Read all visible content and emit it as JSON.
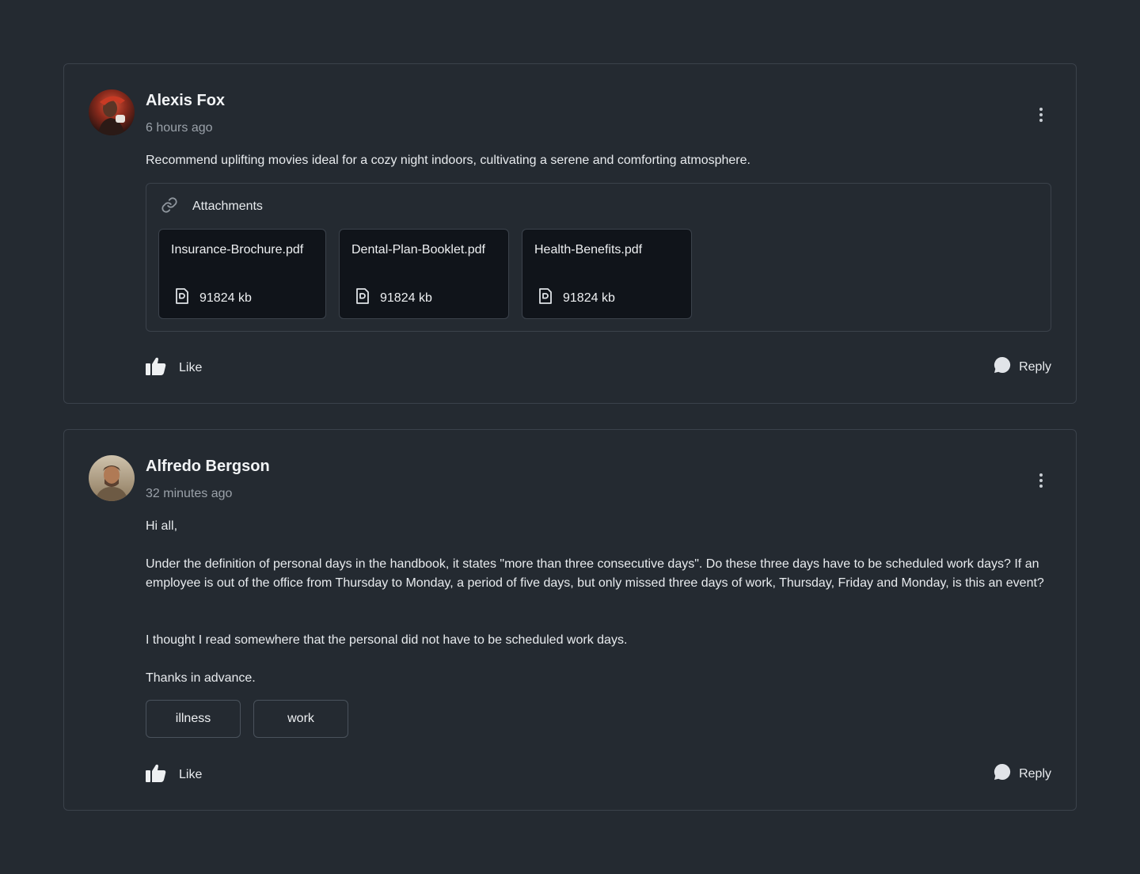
{
  "posts": [
    {
      "author": "Alexis Fox",
      "time": "6 hours ago",
      "body": [
        "Recommend uplifting movies ideal for a cozy night indoors, cultivating a serene and comforting atmosphere."
      ],
      "attachments_label": "Attachments",
      "attachments": [
        {
          "name": "Insurance-Brochure.pdf",
          "size": "91824 kb"
        },
        {
          "name": "Dental-Plan-Booklet.pdf",
          "size": "91824 kb"
        },
        {
          "name": "Health-Benefits.pdf",
          "size": "91824 kb"
        }
      ],
      "like_label": "Like",
      "reply_label": "Reply"
    },
    {
      "author": "Alfredo Bergson",
      "time": "32 minutes ago",
      "body": [
        "Hi all,",
        "Under the definition of personal days in the handbook, it states \"more than three consecutive days\". Do these three days have to be scheduled work days? If an employee is out of the office from Thursday to Monday, a period of five days, but only missed three days of work, Thursday, Friday and Monday, is this an event?",
        "I thought I read somewhere that the personal did not have to be scheduled work days.",
        "Thanks in advance."
      ],
      "tags": [
        "illness",
        "work"
      ],
      "like_label": "Like",
      "reply_label": "Reply"
    }
  ],
  "icons": {
    "more": "kebab-menu-icon",
    "link": "link-icon",
    "file": "document-icon",
    "like": "thumbs-up-icon",
    "reply": "chat-bubble-icon"
  },
  "colors": {
    "background": "#242a31",
    "border": "#3b424b",
    "file_card": "#10141a",
    "muted_text": "#9aa1a9"
  }
}
